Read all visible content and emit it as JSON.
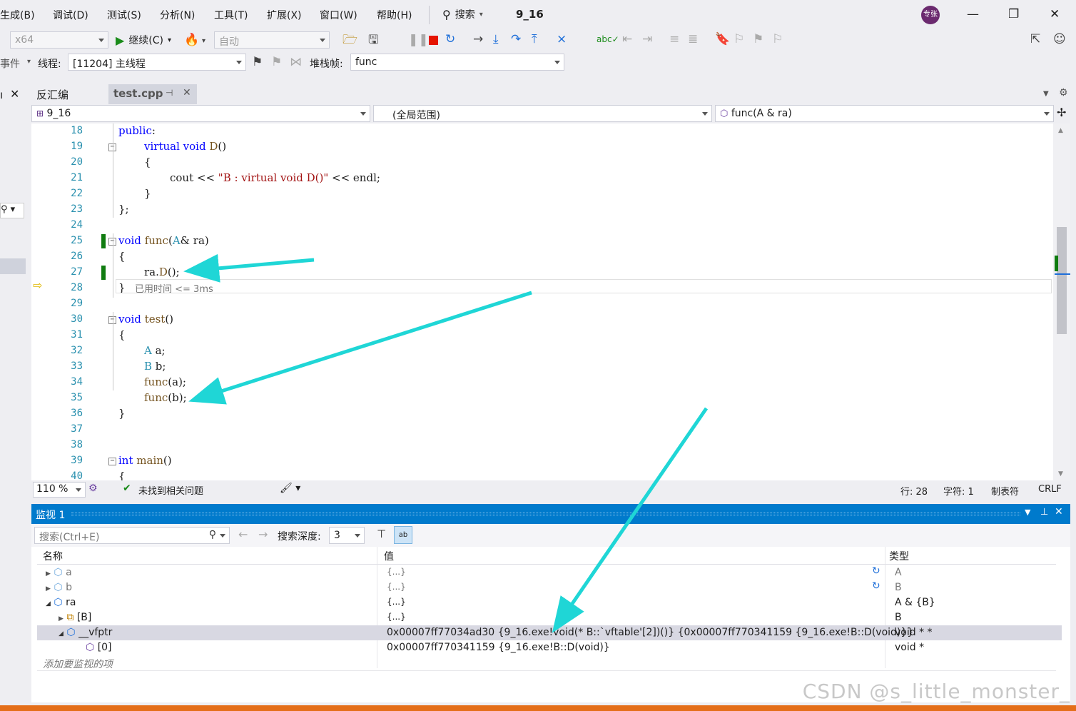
{
  "menu": [
    "生成(B)",
    "调试(D)",
    "测试(S)",
    "分析(N)",
    "工具(T)",
    "扩展(X)",
    "窗口(W)",
    "帮助(H)"
  ],
  "search_label": "搜索",
  "solution_name": "9_16",
  "avatar_text": "专张",
  "toolbar": {
    "platform": "x64",
    "continue_label": "继续(C)",
    "auto_label": "自动"
  },
  "toolbar2": {
    "events_label": "事件",
    "thread_label": "线程:",
    "thread_value": "[11204] 主线程",
    "stackframe_label": "堆栈帧:",
    "stackframe_value": "func"
  },
  "tabs": [
    "反汇编",
    "test.cpp"
  ],
  "nav": {
    "project": "9_16",
    "scope": "(全局范围)",
    "member": "func(A & ra)"
  },
  "code_lines": [
    {
      "n": "18",
      "t": "public:"
    },
    {
      "n": "19",
      "t": "virtual void D()"
    },
    {
      "n": "20",
      "t": "{"
    },
    {
      "n": "21",
      "t": "cout << \"B : virtual void D()\" << endl;"
    },
    {
      "n": "22",
      "t": "}"
    },
    {
      "n": "23",
      "t": "};"
    },
    {
      "n": "24",
      "t": ""
    },
    {
      "n": "25",
      "t": "void func(A& ra)"
    },
    {
      "n": "26",
      "t": "{"
    },
    {
      "n": "27",
      "t": "ra.D();"
    },
    {
      "n": "28",
      "t": "}"
    },
    {
      "n": "29",
      "t": ""
    },
    {
      "n": "30",
      "t": "void test()"
    },
    {
      "n": "31",
      "t": "{"
    },
    {
      "n": "32",
      "t": "A a;"
    },
    {
      "n": "33",
      "t": "B b;"
    },
    {
      "n": "34",
      "t": "func(a);"
    },
    {
      "n": "35",
      "t": "func(b);"
    },
    {
      "n": "36",
      "t": "}"
    },
    {
      "n": "37",
      "t": ""
    },
    {
      "n": "38",
      "t": ""
    },
    {
      "n": "39",
      "t": "int main()"
    },
    {
      "n": "40",
      "t": "{"
    }
  ],
  "elapsed_hint": "已用时间 <= 3ms",
  "status": {
    "zoom": "110 %",
    "issues": "未找到相关问题",
    "line": "行: 28",
    "char": "字符: 1",
    "tabs": "制表符",
    "eol": "CRLF"
  },
  "watch": {
    "title": "监视 1",
    "search_placeholder": "搜索(Ctrl+E)",
    "depth_label": "搜索深度:",
    "depth_value": "3",
    "col_name": "名称",
    "col_value": "值",
    "col_type": "类型",
    "rows": [
      {
        "name": "a",
        "value": "{...}",
        "type": "A"
      },
      {
        "name": "b",
        "value": "{...}",
        "type": "B"
      },
      {
        "name": "ra",
        "value": "{...}",
        "type": "A & {B}"
      },
      {
        "name": "[B]",
        "value": "{...}",
        "type": "B"
      },
      {
        "name": "__vfptr",
        "value": "0x00007ff77034ad30 {9_16.exe!void(* B::`vftable'[2])()} {0x00007ff770341159 {9_16.exe!B::D(void)}}",
        "type": "void * *"
      },
      {
        "name": "[0]",
        "value": "0x00007ff770341159 {9_16.exe!B::D(void)}",
        "type": "void *"
      }
    ],
    "add_item": "添加要监视的项"
  },
  "watermark": "CSDN @s_little_monster_",
  "colors": {
    "accent": "#007acc",
    "arrow": "#1fd6d6",
    "breakpoint_bar": "#107c10"
  }
}
